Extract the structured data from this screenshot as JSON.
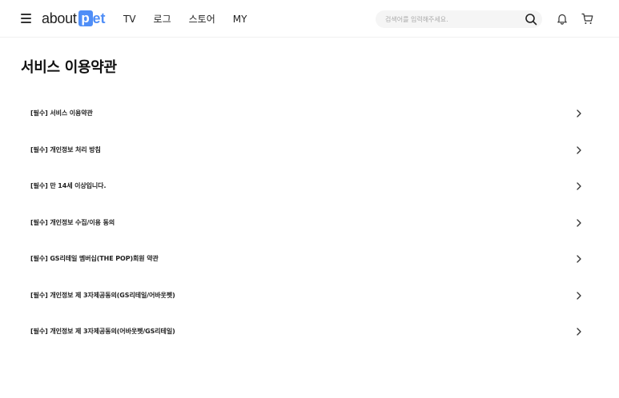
{
  "header": {
    "logo": {
      "about": "about",
      "p": "p",
      "et": "et"
    },
    "nav": [
      "TV",
      "로그",
      "스토어",
      "MY"
    ],
    "search": {
      "placeholder": "검색어를 입력해주세요."
    },
    "icons": [
      "menu-icon",
      "search-icon",
      "bell-icon",
      "cart-icon"
    ],
    "brand_color": "#4f8ef7"
  },
  "page": {
    "title": "서비스 이용약관"
  },
  "terms": [
    {
      "label": "[필수] 서비스 이용약관"
    },
    {
      "label": "[필수] 개인정보 처리 방침"
    },
    {
      "label": "[필수] 만 14세 이상입니다."
    },
    {
      "label": "[필수] 개인정보 수집/이용 동의"
    },
    {
      "label": "[필수] GS리테일 멤버십(THE POP)회원 약관"
    },
    {
      "label": "[필수] 개인정보 제 3자제공동의(GS리테일/어바웃펫)"
    },
    {
      "label": "[필수] 개인정보 제 3자제공동의(어바웃펫/GS리테일)"
    }
  ]
}
